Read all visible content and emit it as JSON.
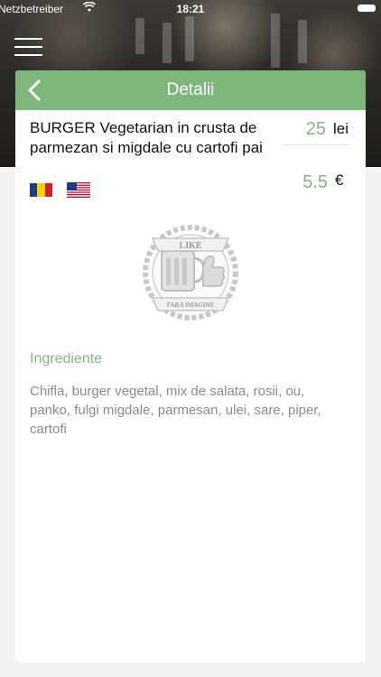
{
  "status_bar": {
    "carrier": "Netzbetreiber",
    "time": "18:21"
  },
  "header": {
    "title": "Detalii"
  },
  "product": {
    "name": "BURGER Vegetarian in crusta de parmezan si migdale cu cartofi pai",
    "price_ron": "25",
    "currency_ron": "lei",
    "price_eur": "5.5",
    "currency_eur": "€"
  },
  "placeholder_image": {
    "top_text": "LIKE",
    "bottom_text": "FARA IMAGINE"
  },
  "ingredients": {
    "title": "Ingrediente",
    "text": "Chifla, burger vegetal, mix de salata, rosii, ou, panko, fulgi migdale, parmesan, ulei, sare, piper, cartofi"
  },
  "colors": {
    "accent": "#7eb77c",
    "text_muted": "#8a8a8a"
  },
  "icons": [
    "wifi-icon",
    "battery-icon",
    "hamburger-menu-icon",
    "back-chevron-icon",
    "romania-flag-icon",
    "usa-flag-icon"
  ]
}
